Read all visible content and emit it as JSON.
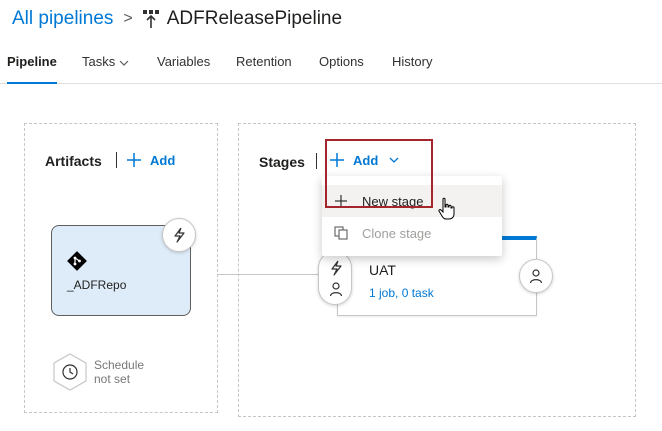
{
  "breadcrumb": {
    "root_label": "All pipelines",
    "separator": ">",
    "pipeline_name": "ADFReleasePipeline"
  },
  "tabs": [
    {
      "label": "Pipeline",
      "active": true
    },
    {
      "label": "Tasks",
      "has_dropdown": true
    },
    {
      "label": "Variables"
    },
    {
      "label": "Retention"
    },
    {
      "label": "Options"
    },
    {
      "label": "History"
    }
  ],
  "artifacts": {
    "title": "Artifacts",
    "add_label": "Add",
    "items": [
      {
        "name": "_ADFRepo",
        "icon": "git-icon",
        "trigger_icon": "lightning-icon"
      }
    ],
    "schedule": {
      "line1": "Schedule",
      "line2": "not set",
      "icon": "clock-icon"
    }
  },
  "stages": {
    "title": "Stages",
    "add_label": "Add",
    "add_menu": [
      {
        "label": "New stage",
        "icon": "plus-icon",
        "state": "hovered"
      },
      {
        "label": "Clone stage",
        "icon": "clone-icon",
        "state": "disabled"
      }
    ],
    "items": [
      {
        "name": "UAT",
        "summary": "1 job, 0 task",
        "pre_icons": [
          "lightning-icon",
          "person-icon"
        ],
        "post_icon": "person-icon"
      }
    ]
  },
  "colors": {
    "accent": "#0078d4",
    "artifact_bg": "#deecf9",
    "highlight_border": "#a4262c"
  }
}
